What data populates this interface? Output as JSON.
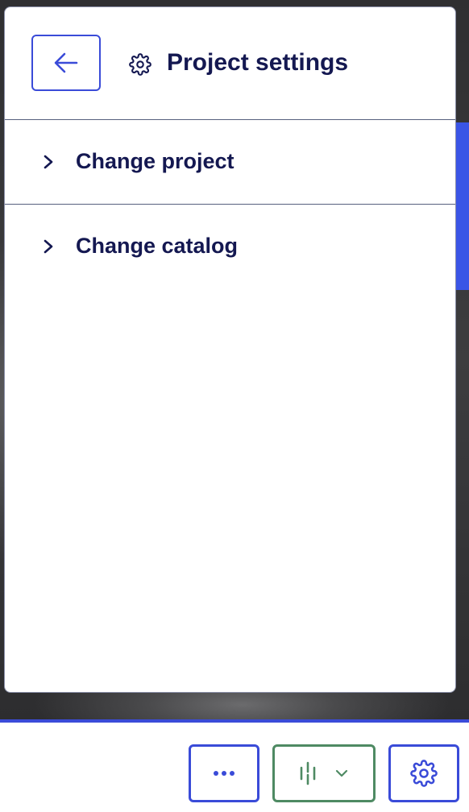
{
  "panel": {
    "title": "Project settings",
    "back_icon": "arrow-left-icon",
    "title_icon": "gear-icon",
    "items": [
      {
        "label": "Change project",
        "icon": "chevron-right-icon"
      },
      {
        "label": "Change catalog",
        "icon": "chevron-right-icon"
      }
    ]
  },
  "toolbar": {
    "buttons": [
      {
        "icon": "more-horizontal-icon"
      },
      {
        "icon": "timeline-icon",
        "secondary_icon": "chevron-down-icon"
      },
      {
        "icon": "gear-icon"
      }
    ]
  },
  "colors": {
    "accent": "#3a4bd8",
    "title_text": "#141851",
    "timeline_border": "#4e8a63",
    "divider": "#56607e"
  }
}
